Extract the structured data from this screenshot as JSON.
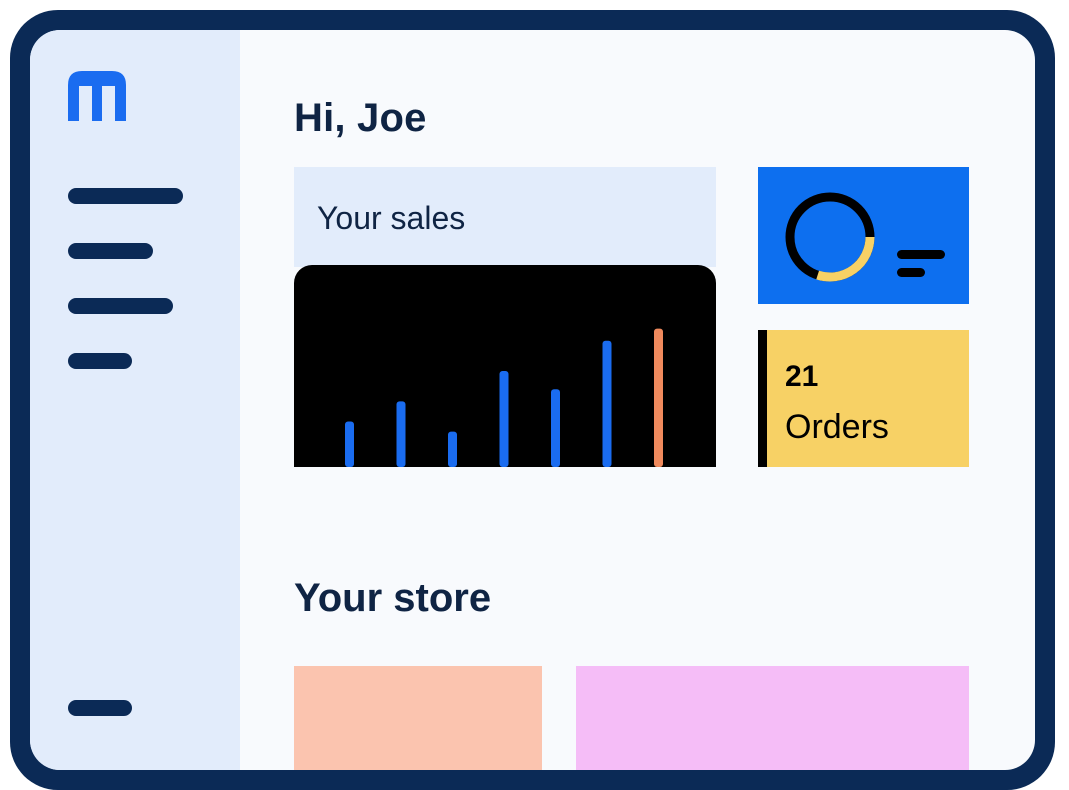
{
  "header": {
    "greeting": "Hi, Joe"
  },
  "sidebar": {
    "logo_icon": "brand-logo-icon",
    "items": [
      {
        "icon": "nav-line"
      },
      {
        "icon": "nav-line"
      },
      {
        "icon": "nav-line"
      },
      {
        "icon": "nav-line"
      }
    ],
    "footer_item": {
      "icon": "nav-line"
    }
  },
  "sales": {
    "title": "Your sales",
    "chart_data": {
      "type": "bar",
      "title": "",
      "xlabel": "",
      "ylabel": "",
      "values": [
        45,
        65,
        35,
        95,
        77,
        125,
        137
      ],
      "colors": [
        "#1a6cf0",
        "#1a6cf0",
        "#1a6cf0",
        "#1a6cf0",
        "#1a6cf0",
        "#1a6cf0",
        "#f08a5d"
      ],
      "ylim": [
        0,
        200
      ],
      "grid": false
    }
  },
  "stat_card": {
    "icon": "donut-chart-icon",
    "progress": 0.3,
    "colors": {
      "background": "#0d6fef",
      "ring": "#000000",
      "progress": "#f7d165"
    }
  },
  "orders": {
    "count": "21",
    "label": "Orders",
    "color": "#f7d165"
  },
  "store": {
    "title": "Your store",
    "tiles": [
      {
        "color": "#fbc4af"
      },
      {
        "color": "#f5bdf7"
      }
    ]
  },
  "colors": {
    "frame": "#0b2a56",
    "sidebar": "#e2ecfb",
    "accent": "#0d6fef"
  }
}
